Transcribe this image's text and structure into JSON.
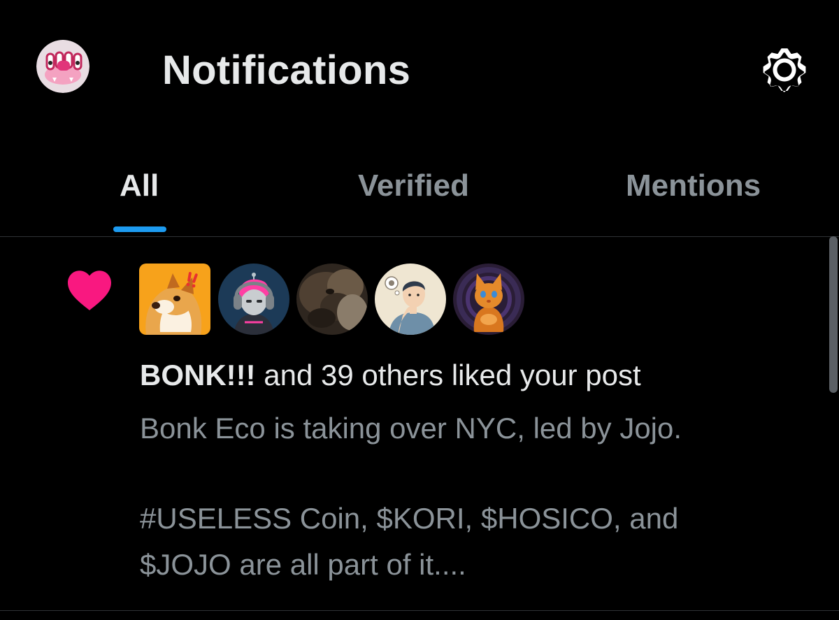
{
  "header": {
    "title": "Notifications",
    "profile_icon": "ghost-avatar-icon",
    "settings_icon": "gear-icon"
  },
  "tabs": [
    {
      "label": "All",
      "active": true
    },
    {
      "label": "Verified",
      "active": false
    },
    {
      "label": "Mentions",
      "active": false
    }
  ],
  "notification": {
    "type_icon": "heart-icon",
    "avatars": [
      {
        "name": "bonk-dog-avatar"
      },
      {
        "name": "pink-hair-robot-avatar"
      },
      {
        "name": "blurry-animal-avatar"
      },
      {
        "name": "thinking-man-avatar"
      },
      {
        "name": "orange-cat-avatar"
      }
    ],
    "actor": "BONK!!!",
    "action_text": " and 39 others liked your post",
    "snippet_lines": [
      "Bonk Eco is taking over NYC, led by Jojo.",
      "",
      "#USELESS Coin, $KORI, $HOSICO, and",
      "$JOJO are all part of it...."
    ]
  },
  "colors": {
    "background": "#000000",
    "text_primary": "#e7e9ea",
    "text_secondary": "#8b9399",
    "accent": "#1d9bf0",
    "like": "#f91880",
    "divider": "#2f3336"
  }
}
